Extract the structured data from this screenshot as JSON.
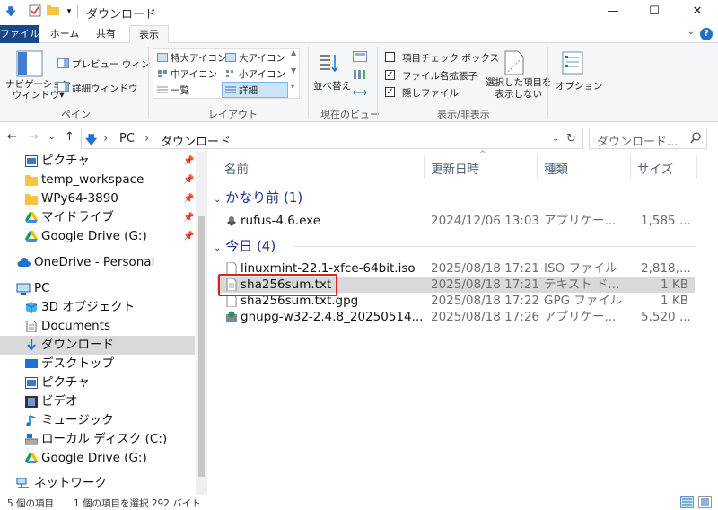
{
  "window": {
    "title": "ダウンロード",
    "minimize_icon": "—",
    "maximize_icon": "☐",
    "close_icon": "✕"
  },
  "tabs": [
    "ファイル",
    "ホーム",
    "共有",
    "表示"
  ],
  "ribbon": {
    "pane": {
      "nav_pane_label": "ナビゲーション\nウィンドウ▾",
      "preview_label": "プレビュー ウィンドウ",
      "details_label": "詳細ウィンドウ",
      "group": "ペイン"
    },
    "layout": {
      "items": [
        "特大アイコン",
        "大アイコン",
        "中アイコン",
        "小アイコン",
        "一覧",
        "詳細"
      ],
      "selected": "詳細",
      "group": "レイアウト"
    },
    "current_view": {
      "sort_label": "並べ替え",
      "group": "現在のビュー"
    },
    "show_hide": {
      "item_checkbox": "項目チェック ボックス",
      "item_checkbox_checked": false,
      "ext_label": "ファイル名拡張子",
      "ext_checked": true,
      "hidden_label": "隠しファイル",
      "hidden_checked": true,
      "hide_selected": "選択した項目を\n表示しない",
      "group": "表示/非表示"
    },
    "options_label": "オプション"
  },
  "address": {
    "crumbs": [
      "PC",
      "ダウンロード"
    ],
    "search_placeholder": "ダウンロード..."
  },
  "nav": {
    "items": [
      {
        "label": "ピクチャ",
        "icon": "pictures-icon",
        "pinned": true
      },
      {
        "label": "temp_workspace",
        "icon": "folder-icon",
        "pinned": true
      },
      {
        "label": "WPy64-3890",
        "icon": "folder-icon",
        "pinned": true
      },
      {
        "label": "マイドライブ",
        "icon": "google-drive-icon",
        "pinned": true
      },
      {
        "label": "Google Drive (G:)",
        "icon": "google-drive-icon",
        "pinned": true
      },
      {
        "label": "OneDrive - Personal",
        "icon": "cloud-icon",
        "pinned": false
      },
      {
        "label": "PC",
        "icon": "pc-icon",
        "pinned": false
      },
      {
        "label": "3D オブジェクト",
        "icon": "3d-objects-icon",
        "pinned": false
      },
      {
        "label": "Documents",
        "icon": "documents-icon",
        "pinned": false
      },
      {
        "label": "ダウンロード",
        "icon": "download-icon",
        "pinned": false
      },
      {
        "label": "デスクトップ",
        "icon": "desktop-icon",
        "pinned": false
      },
      {
        "label": "ピクチャ",
        "icon": "pictures-icon",
        "pinned": false
      },
      {
        "label": "ビデオ",
        "icon": "video-icon",
        "pinned": false
      },
      {
        "label": "ミュージック",
        "icon": "music-icon",
        "pinned": false
      },
      {
        "label": "ローカル ディスク (C:)",
        "icon": "disk-icon",
        "pinned": false
      },
      {
        "label": "Google Drive (G:)",
        "icon": "google-drive-icon",
        "pinned": false
      },
      {
        "label": "ネットワーク",
        "icon": "network-icon",
        "pinned": false
      }
    ],
    "selected_label": "ダウンロード"
  },
  "columns": [
    "名前",
    "更新日時",
    "種類",
    "サイズ"
  ],
  "groups": [
    {
      "title": "かなり前 (1)",
      "files": [
        {
          "name": "rufus-4.6.exe",
          "date": "2024/12/06 13:03",
          "type": "アプリケー...",
          "size": "1,585 ...",
          "icon": "exe-icon"
        }
      ]
    },
    {
      "title": "今日 (4)",
      "files": [
        {
          "name": "linuxmint-22.1-xfce-64bit.iso",
          "date": "2025/08/18 17:21",
          "type": "ISO ファイル",
          "size": "2,818,...",
          "icon": "iso-file-icon"
        },
        {
          "name": "sha256sum.txt",
          "date": "2025/08/18 17:21",
          "type": "テキスト ド...",
          "size": "1 KB",
          "icon": "text-file-icon",
          "selected": true
        },
        {
          "name": "sha256sum.txt.gpg",
          "date": "2025/08/18 17:22",
          "type": "GPG ファイル",
          "size": "1 KB",
          "icon": "gpg-file-icon"
        },
        {
          "name": "gnupg-w32-2.4.8_20250514...",
          "date": "2025/08/18 17:26",
          "type": "アプリケー...",
          "size": "5,520 ...",
          "icon": "installer-icon"
        }
      ]
    }
  ],
  "status": {
    "count": "5 個の項目",
    "selection": "1 個の項目を選択  292 バイト"
  },
  "colors": {
    "file_tab": "#19478a",
    "group_header": "#1e3287",
    "highlight_box": "#e02020",
    "selection": "#d9d9d9"
  }
}
